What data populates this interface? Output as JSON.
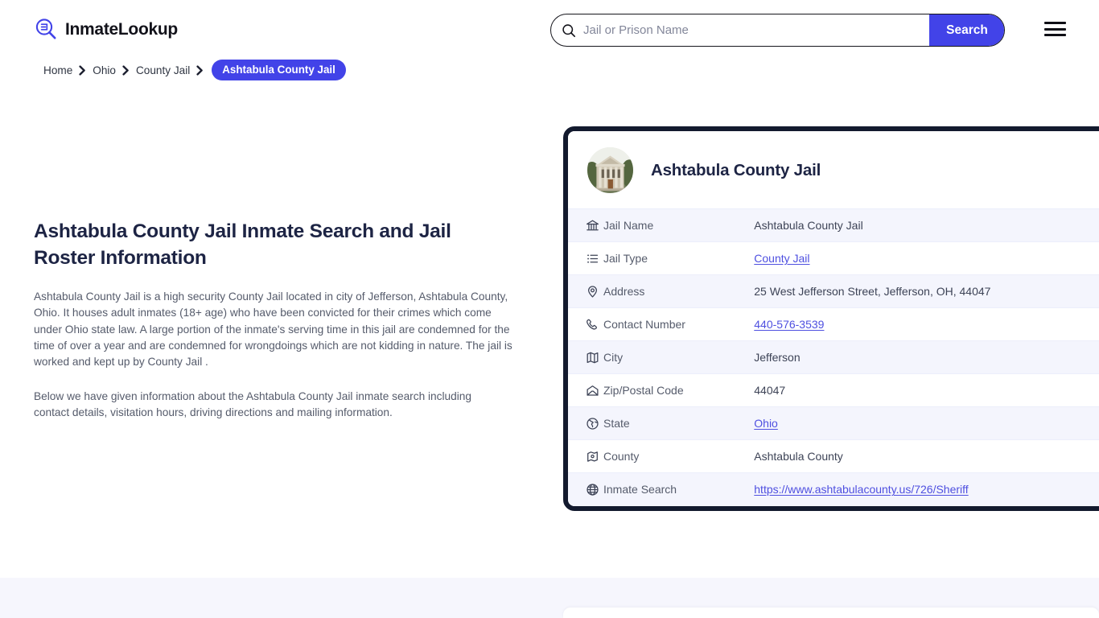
{
  "header": {
    "brand_name": "InmateLookup",
    "brand_icon": "magnifier-list-icon",
    "menu_icon": "hamburger-menu-icon",
    "search": {
      "icon": "search-icon",
      "placeholder": "Jail or Prison Name",
      "value": "",
      "button_label": "Search"
    },
    "accent_color": "#4243e8"
  },
  "breadcrumb": {
    "items": [
      {
        "label": "Home",
        "current": false
      },
      {
        "label": "Ohio",
        "current": false
      },
      {
        "label": "County Jail",
        "current": false
      }
    ],
    "current": "Ashtabula County Jail",
    "separator": "›"
  },
  "main": {
    "title": "Ashtabula County Jail Inmate Search and Jail Roster Information",
    "paragraph_1": "Ashtabula County Jail is a high security County Jail located in city of Jefferson, Ashtabula County, Ohio. It houses adult inmates (18+ age) who have been convicted for their crimes which come under Ohio state law. A large portion of the inmate's serving time in this jail are condemned for the time of over a year and are condemned for wrongdoings which are not kidding in nature. The jail is worked and kept up by County Jail .",
    "paragraph_2": "Below we have given information about the Ashtabula County Jail inmate search including contact details, visitation hours, driving directions and mailing information."
  },
  "info_card": {
    "avatar_alt": "courthouse-photo",
    "title": "Ashtabula County Jail",
    "border_color": "#131a2e",
    "row_alt_color": "#f4f5fd",
    "link_color": "#4e4fe0",
    "rows": [
      {
        "icon": "bank-building-icon",
        "label": "Jail Name",
        "value": "Ashtabula County Jail",
        "link": false
      },
      {
        "icon": "list-icon",
        "label": "Jail Type",
        "value": "County Jail",
        "link": true
      },
      {
        "icon": "map-pin-icon",
        "label": "Address",
        "value": "25 West Jefferson Street, Jefferson, OH, 44047",
        "link": false
      },
      {
        "icon": "phone-icon",
        "label": "Contact Number",
        "value": "440-576-3539",
        "link": true
      },
      {
        "icon": "folded-map-icon",
        "label": "City",
        "value": "Jefferson",
        "link": false
      },
      {
        "icon": "envelope-icon",
        "label": "Zip/Postal Code",
        "value": "44047",
        "link": false
      },
      {
        "icon": "globe-americas-icon",
        "label": "State",
        "value": "Ohio",
        "link": true
      },
      {
        "icon": "county-marker-icon",
        "label": "County",
        "value": "Ashtabula County",
        "link": false
      },
      {
        "icon": "globe-grid-icon",
        "label": "Inmate Search",
        "value": "https://www.ashtabulacounty.us/726/Sheriff",
        "link": true
      }
    ]
  }
}
